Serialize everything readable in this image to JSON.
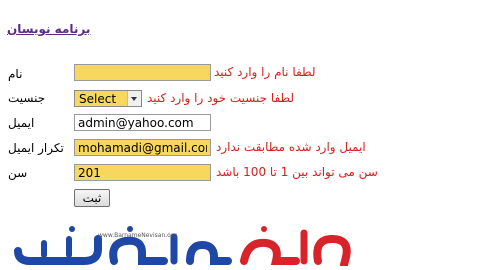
{
  "page": {
    "title": "برنامه نویسان"
  },
  "form": {
    "name": {
      "label": "نام",
      "value": "",
      "error": "لطفا نام را وارد کنید"
    },
    "gender": {
      "label": "جنسیت",
      "selected": "Select",
      "error": "لطفا جنسیت خود را وارد کنید"
    },
    "email": {
      "label": "ایمیل",
      "value": "admin@yahoo.com"
    },
    "email_confirm": {
      "label": "تکرار ایمیل",
      "value": "mohamadi@gmail.com",
      "error": "ایمیل وارد شده مطابقت ندارد"
    },
    "age": {
      "label": "سن",
      "value": "201",
      "error": "سن می تواند بین 1 تا 100 باشد"
    },
    "submit_label": "ثبت"
  },
  "logo": {
    "text": "برنامه نویسان",
    "url": "www.BarnameNevisan.org"
  },
  "colors": {
    "invalid_field": "#f8d75f",
    "error_text": "#d42020",
    "title": "#5a2d82",
    "logo_blue": "#1f47a6",
    "logo_red": "#d8232a"
  }
}
